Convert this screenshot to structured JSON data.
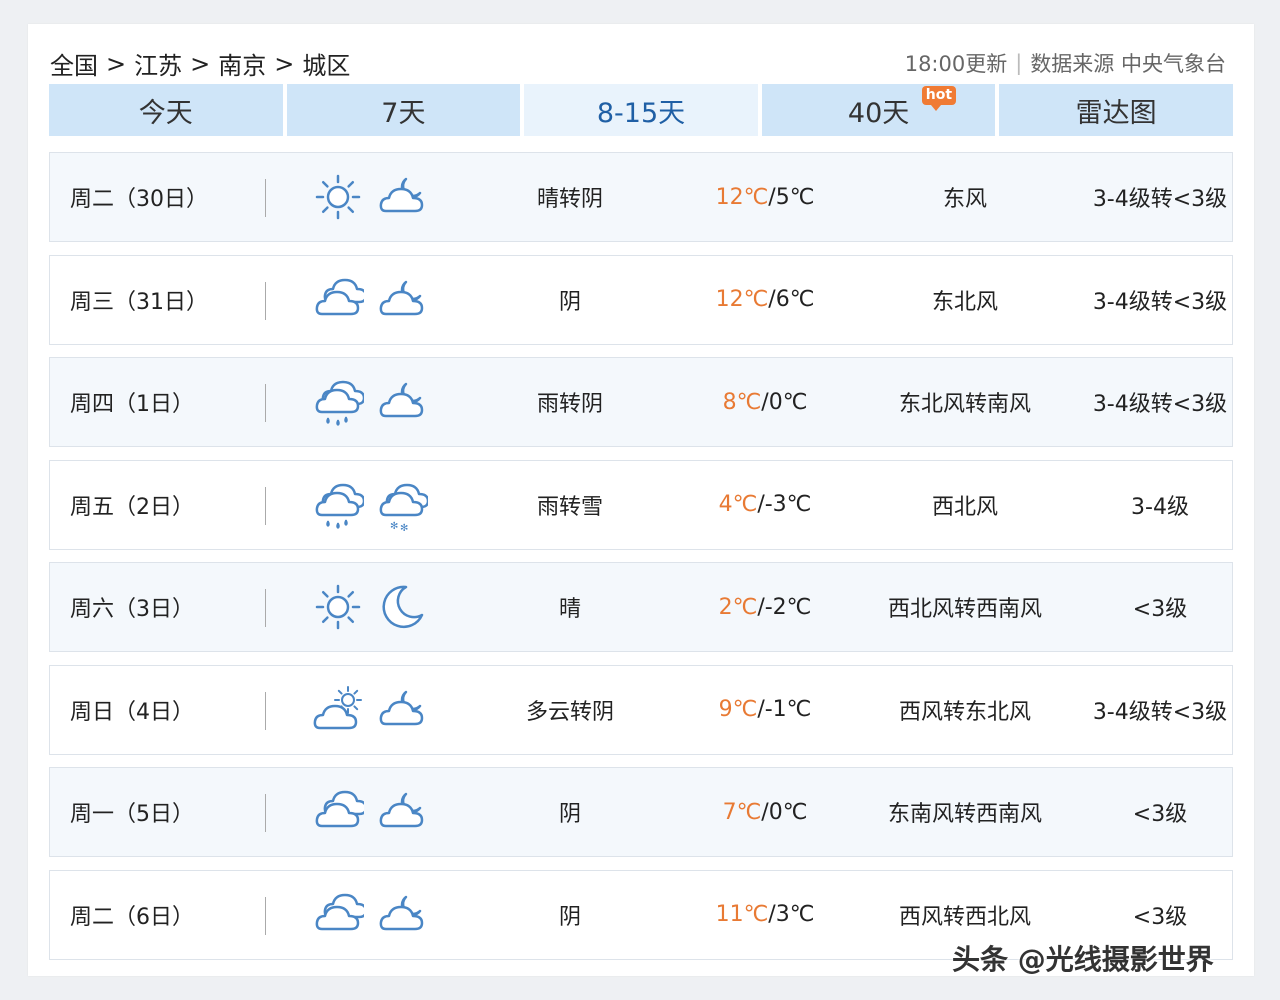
{
  "breadcrumb": [
    "全国",
    "江苏",
    "南京",
    "城区"
  ],
  "breadcrumb_sep": ">",
  "header": {
    "update_time": "18:00更新",
    "divider": "|",
    "source": "数据来源 中央气象台"
  },
  "tabs": [
    {
      "label": "今天",
      "active": false
    },
    {
      "label": "7天",
      "active": false
    },
    {
      "label": "8-15天",
      "active": true
    },
    {
      "label": "40天",
      "active": false,
      "badge": "hot"
    },
    {
      "label": "雷达图",
      "active": false
    }
  ],
  "colors": {
    "accent": "#1f5fa5",
    "tab_bg": "#cfe5f8",
    "high_temp": "#e87a34",
    "icon_stroke": "#4a86c5"
  },
  "forecast": [
    {
      "day": "周二（30日）",
      "icon_day": "sunny-icon",
      "icon_night": "cloudy-night-icon",
      "condition": "晴转阴",
      "high": "12℃",
      "low": "/5℃",
      "wind": "东风",
      "level": "3-4级转<3级"
    },
    {
      "day": "周三（31日）",
      "icon_day": "overcast-icon",
      "icon_night": "cloudy-night-icon",
      "condition": "阴",
      "high": "12℃",
      "low": "/6℃",
      "wind": "东北风",
      "level": "3-4级转<3级"
    },
    {
      "day": "周四（1日）",
      "icon_day": "rain-icon",
      "icon_night": "cloudy-night-icon",
      "condition": "雨转阴",
      "high": "8℃",
      "low": "/0℃",
      "wind": "东北风转南风",
      "level": "3-4级转<3级"
    },
    {
      "day": "周五（2日）",
      "icon_day": "rain-icon",
      "icon_night": "snow-icon",
      "condition": "雨转雪",
      "high": "4℃",
      "low": "/-3℃",
      "wind": "西北风",
      "level": "3-4级"
    },
    {
      "day": "周六（3日）",
      "icon_day": "sunny-icon",
      "icon_night": "moon-icon",
      "condition": "晴",
      "high": "2℃",
      "low": "/-2℃",
      "wind": "西北风转西南风",
      "level": "<3级"
    },
    {
      "day": "周日（4日）",
      "icon_day": "partly-cloudy-icon",
      "icon_night": "cloudy-night-icon",
      "condition": "多云转阴",
      "high": "9℃",
      "low": "/-1℃",
      "wind": "西风转东北风",
      "level": "3-4级转<3级"
    },
    {
      "day": "周一（5日）",
      "icon_day": "overcast-icon",
      "icon_night": "cloudy-night-icon",
      "condition": "阴",
      "high": "7℃",
      "low": "/0℃",
      "wind": "东南风转西南风",
      "level": "<3级"
    },
    {
      "day": "周二（6日）",
      "icon_day": "overcast-icon",
      "icon_night": "cloudy-night-icon",
      "condition": "阴",
      "high": "11℃",
      "low": "/3℃",
      "wind": "西风转西北风",
      "level": "<3级"
    }
  ],
  "watermark": "头条 @光线摄影世界"
}
